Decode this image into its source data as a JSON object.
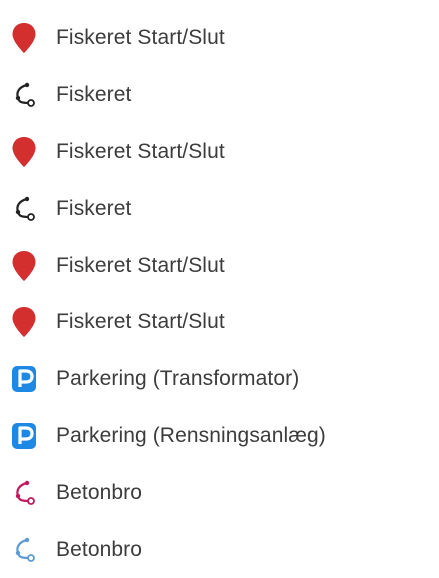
{
  "legend": {
    "items": [
      {
        "label": "Fiskeret Start/Slut",
        "icon": "map-pin-icon",
        "color": "#d32f2f"
      },
      {
        "label": "Fiskeret",
        "icon": "route-line-icon",
        "color": "#222222"
      },
      {
        "label": "Fiskeret Start/Slut",
        "icon": "map-pin-icon",
        "color": "#d32f2f"
      },
      {
        "label": "Fiskeret",
        "icon": "route-line-icon",
        "color": "#222222"
      },
      {
        "label": "Fiskeret Start/Slut",
        "icon": "map-pin-icon",
        "color": "#d32f2f"
      },
      {
        "label": "Fiskeret Start/Slut",
        "icon": "map-pin-icon",
        "color": "#d32f2f"
      },
      {
        "label": "Parkering (Transformator)",
        "icon": "parking-icon",
        "color": "#1e88e5"
      },
      {
        "label": "Parkering (Rensningsanlæg)",
        "icon": "parking-icon",
        "color": "#1e88e5"
      },
      {
        "label": "Betonbro",
        "icon": "route-line-icon",
        "color": "#c2185b"
      },
      {
        "label": "Betonbro",
        "icon": "route-line-icon",
        "color": "#5c9bd6"
      }
    ]
  }
}
